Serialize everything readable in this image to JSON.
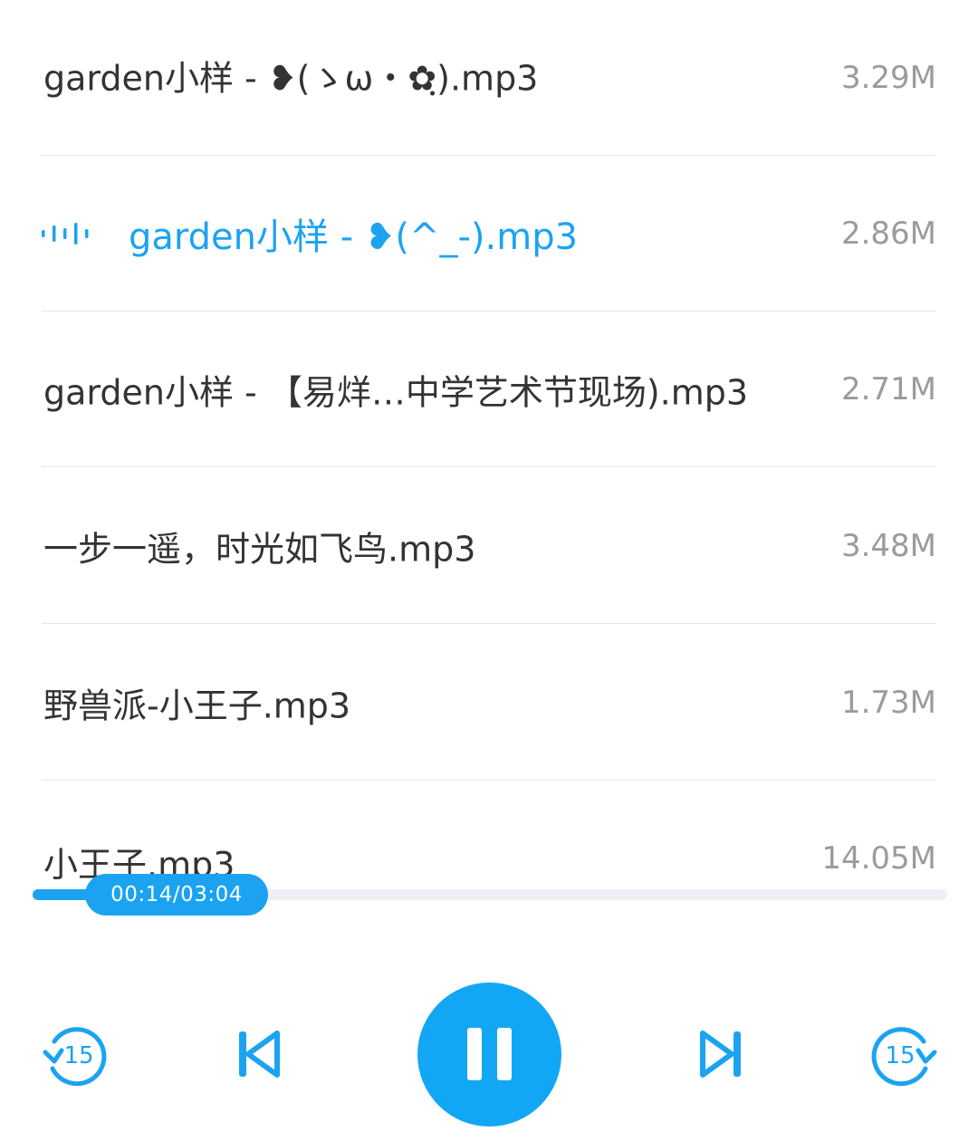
{
  "playlist": [
    {
      "name": "garden小样 - ❥(ゝω・✿ฺ).mp3",
      "size": "3.29M",
      "playing": false
    },
    {
      "name": "garden小样 - ❥(^_-).mp3",
      "size": "2.86M",
      "playing": true
    },
    {
      "name": "garden小样 - 【易烊…中学艺术节现场).mp3",
      "size": "2.71M",
      "playing": false
    },
    {
      "name": "一步一遥，时光如飞鸟.mp3",
      "size": "3.48M",
      "playing": false
    },
    {
      "name": "野兽派-小王子.mp3",
      "size": "1.73M",
      "playing": false
    },
    {
      "name": "小王子.mp3",
      "size": "14.05M",
      "playing": false
    }
  ],
  "player": {
    "time_display": "00:14/03:04",
    "progress_fraction": 0.076,
    "state": "playing",
    "skip_back_seconds": "15",
    "skip_forward_seconds": "15"
  },
  "icons": {
    "now_playing": "equalizer-icon",
    "skip_back": "rewind-15-icon",
    "previous": "previous-track-icon",
    "pause": "pause-icon",
    "next": "next-track-icon",
    "skip_forward": "forward-15-icon"
  },
  "colors": {
    "accent": "#1ba3f2",
    "text": "#333333",
    "secondary_text": "#9b9b9b",
    "divider": "#e6e6e6",
    "track": "#eef0f6"
  }
}
